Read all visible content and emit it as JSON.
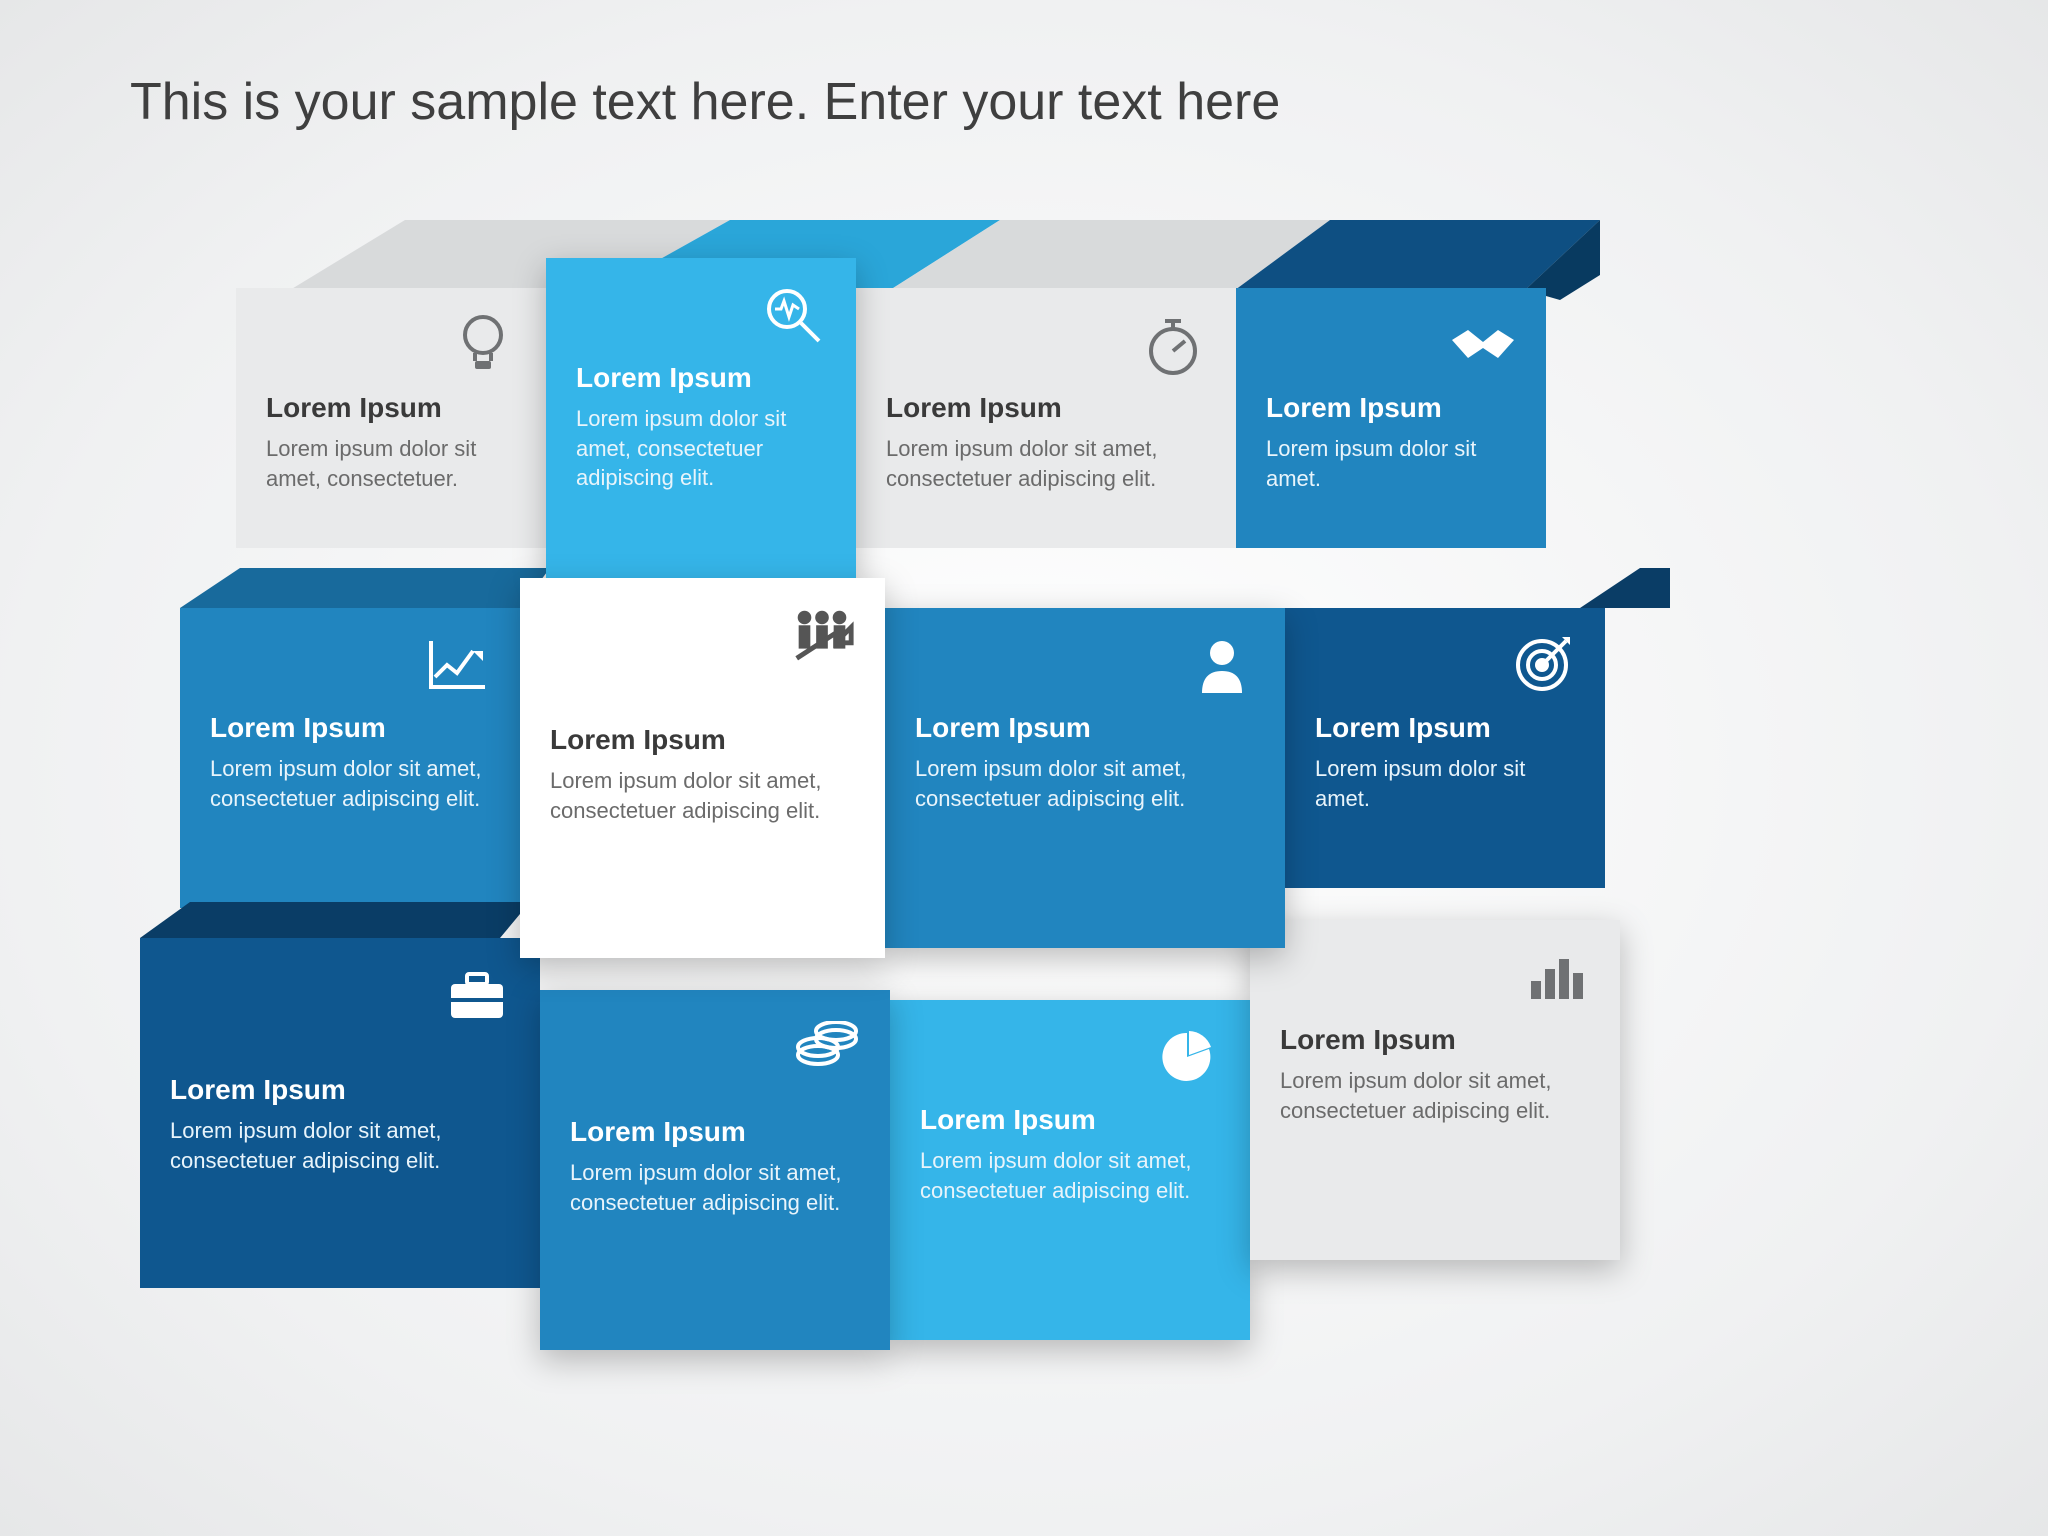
{
  "title": "This is your sample text here. Enter your text here",
  "colors": {
    "light_gray": "#e9eaeb",
    "white": "#ffffff",
    "sky": "#35b5e9",
    "blue": "#2185bf",
    "navy": "#0f578f",
    "icon_gray": "#6f7173",
    "icon_white": "#ffffff"
  },
  "boxes": {
    "r1c1": {
      "heading": "Lorem Ipsum",
      "body": "Lorem ipsum dolor sit amet, consectetuer.",
      "icon": "lightbulb"
    },
    "r1c2": {
      "heading": "Lorem Ipsum",
      "body": "Lorem ipsum dolor sit amet, consectetuer adipiscing elit.",
      "icon": "magnifier-pulse"
    },
    "r1c3": {
      "heading": "Lorem Ipsum",
      "body": "Lorem ipsum dolor sit amet, consectetuer adipiscing elit.",
      "icon": "stopwatch"
    },
    "r1c4": {
      "heading": "Lorem Ipsum",
      "body": "Lorem ipsum dolor sit amet.",
      "icon": "handshake"
    },
    "r2c1": {
      "heading": "Lorem Ipsum",
      "body": "Lorem ipsum dolor sit amet, consectetuer adipiscing elit.",
      "icon": "line-chart"
    },
    "r2c2": {
      "heading": "Lorem Ipsum",
      "body": "Lorem ipsum dolor sit amet, consectetuer adipiscing elit.",
      "icon": "people-arrow"
    },
    "r2c3": {
      "heading": "Lorem Ipsum",
      "body": "Lorem ipsum dolor sit amet, consectetuer adipiscing elit.",
      "icon": "user"
    },
    "r2c4": {
      "heading": "Lorem Ipsum",
      "body": "Lorem ipsum dolor sit amet.",
      "icon": "target"
    },
    "r3c1": {
      "heading": "Lorem Ipsum",
      "body": "Lorem ipsum dolor sit amet, consectetuer adipiscing elit.",
      "icon": "briefcase"
    },
    "r3c2": {
      "heading": "Lorem Ipsum",
      "body": "Lorem ipsum dolor sit amet, consectetuer adipiscing elit.",
      "icon": "coins"
    },
    "r3c3": {
      "heading": "Lorem Ipsum",
      "body": "Lorem ipsum dolor sit amet, consectetuer adipiscing elit.",
      "icon": "pie"
    },
    "r3c4": {
      "heading": "Lorem Ipsum",
      "body": "Lorem ipsum dolor sit amet, consectetuer adipiscing elit.",
      "icon": "bar-chart"
    }
  }
}
